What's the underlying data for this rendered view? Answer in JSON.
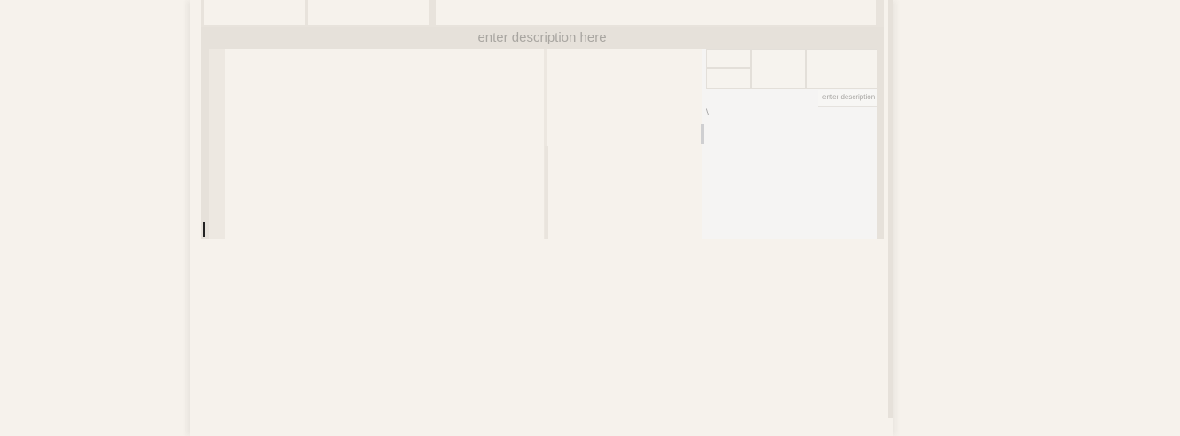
{
  "description_bar": {
    "placeholder": "enter description here"
  },
  "preview": {
    "description_placeholder": "enter description here",
    "glyph": "\\"
  }
}
